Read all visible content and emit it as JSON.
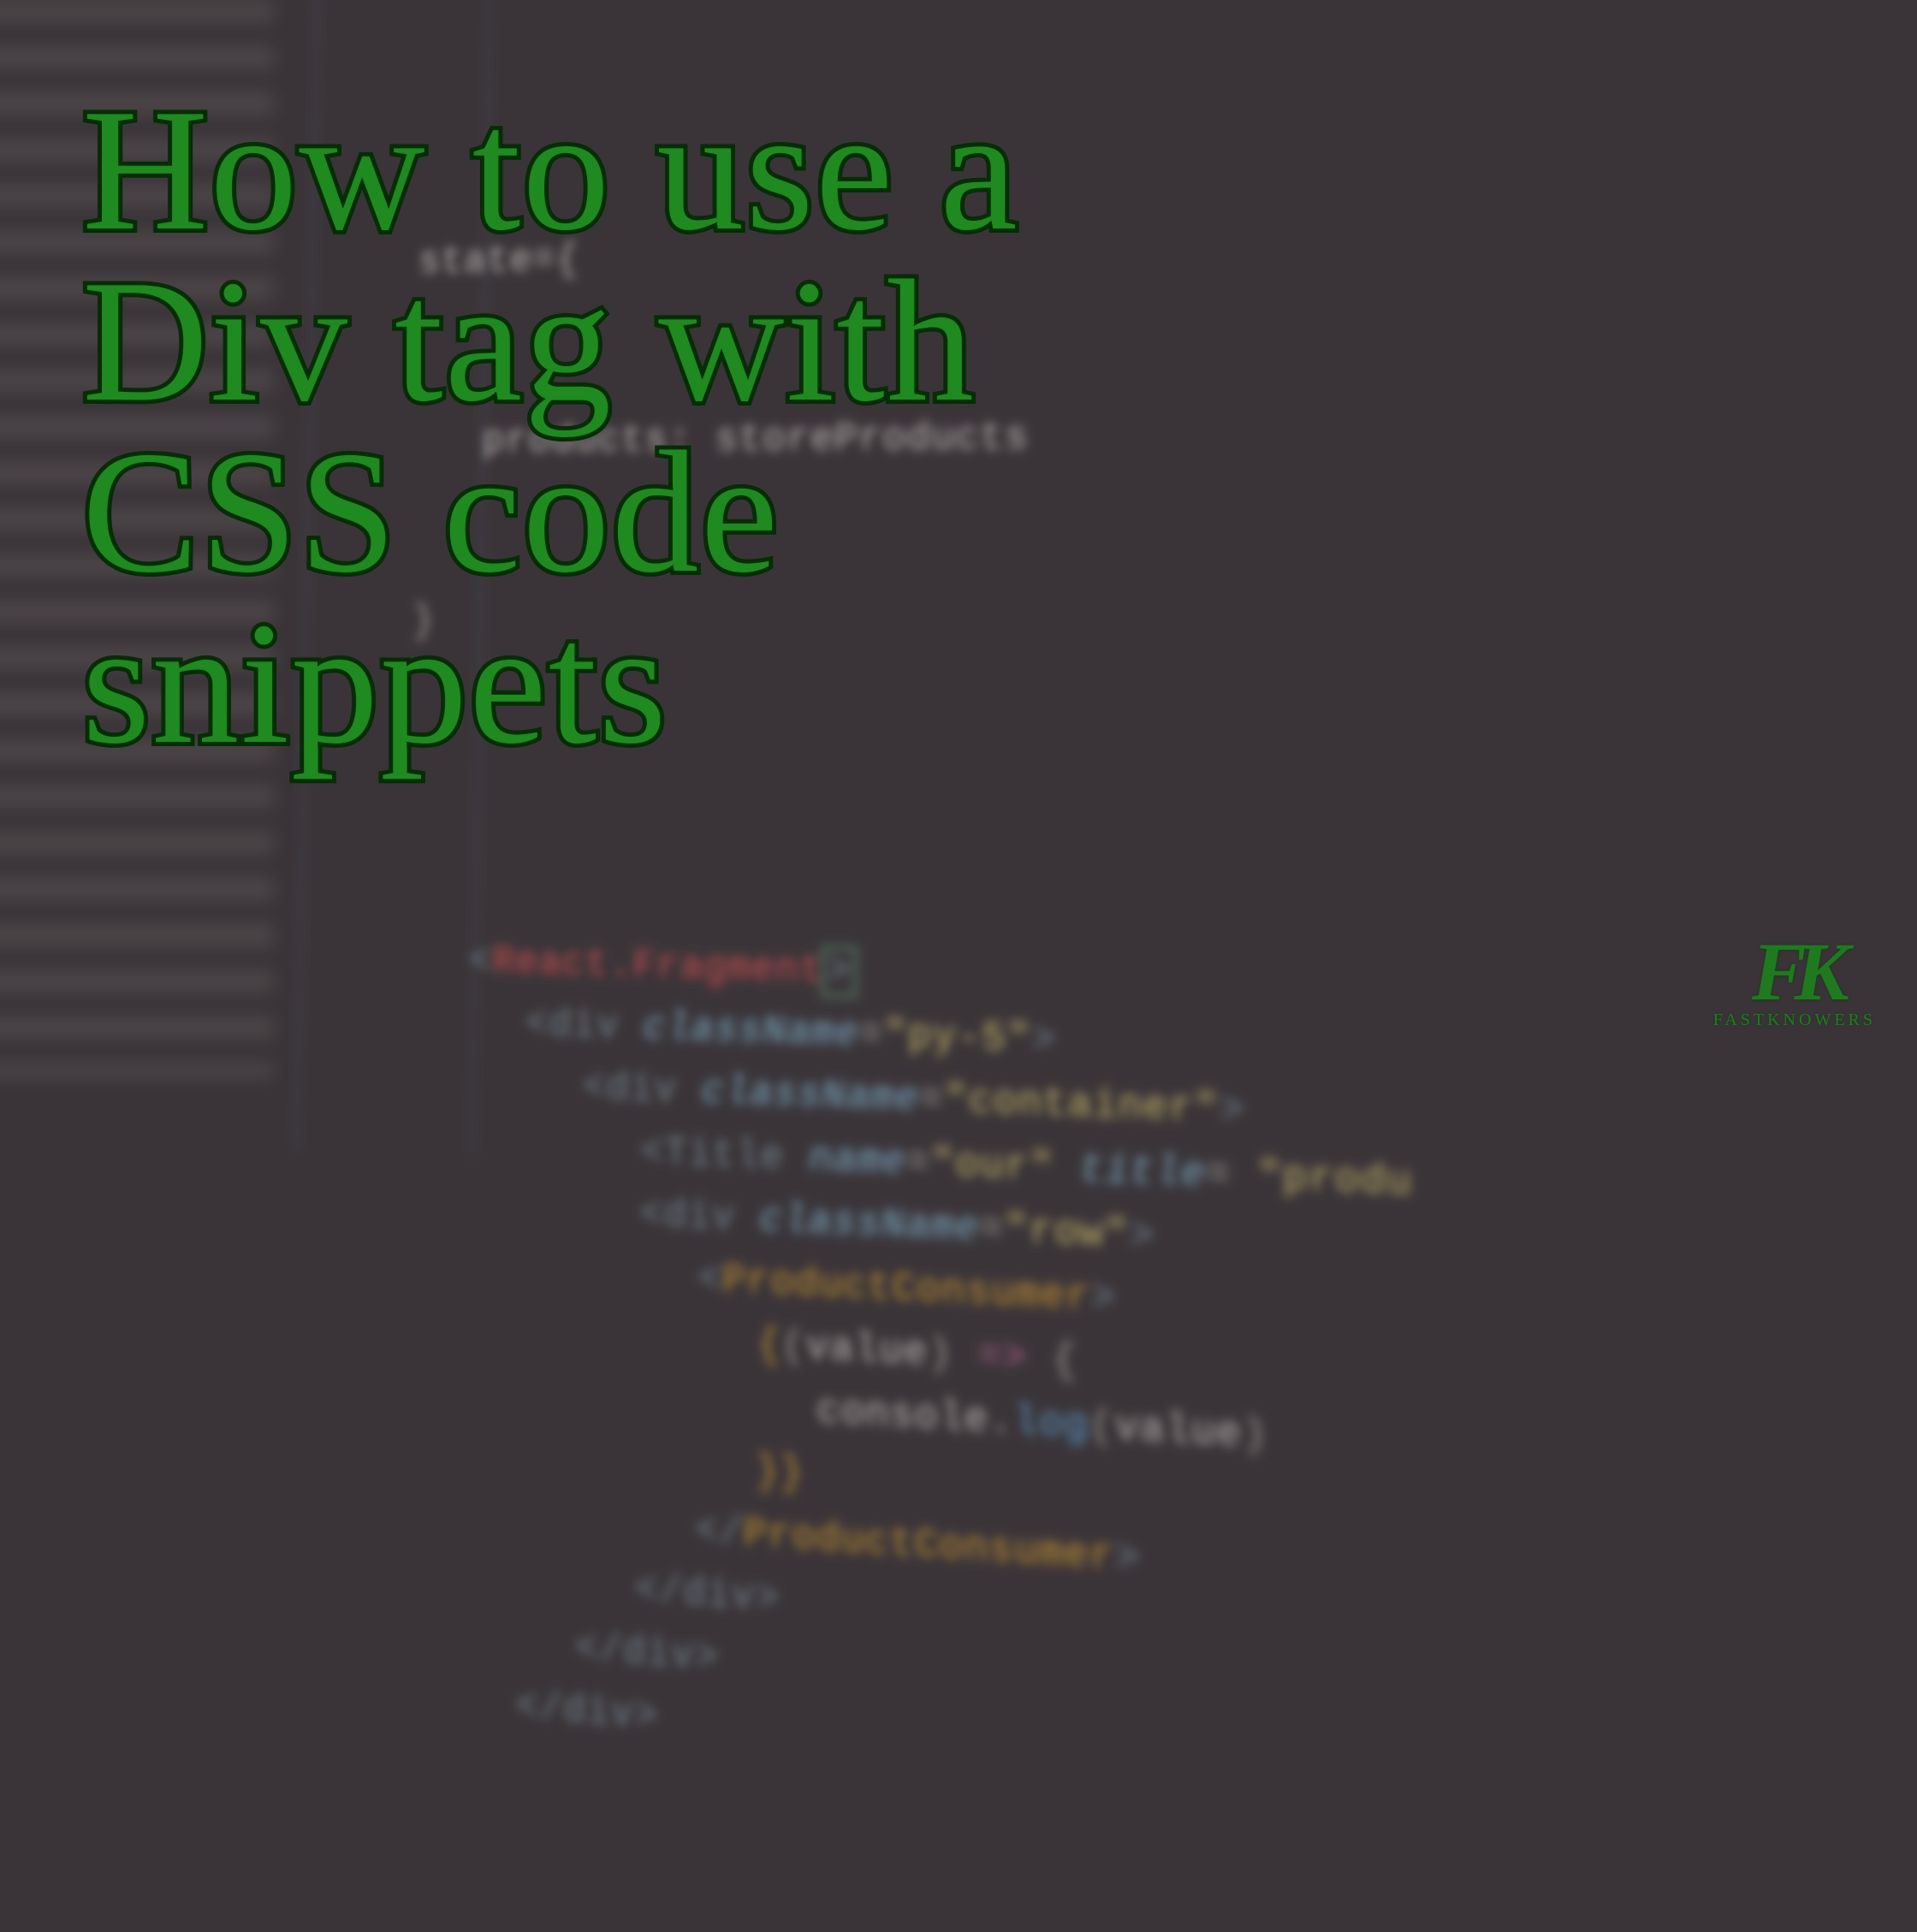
{
  "title_lines": [
    "How to use a",
    "Div tag with",
    "CSS code",
    "snippets"
  ],
  "watermark": {
    "initials": "FK",
    "name": "FASTKNOWERS"
  },
  "code": {
    "prelude": [
      {
        "text": "state={",
        "cls": "w"
      },
      {
        "text": "products: storeProducts",
        "cls": "w"
      },
      {
        "text": "}",
        "cls": "punc"
      }
    ],
    "lines": [
      {
        "n": "",
        "indent": 3,
        "tokens": [
          {
            "t": "<",
            "c": "delim"
          },
          {
            "t": "React.Fragment",
            "c": "tag"
          },
          {
            "t": ">",
            "c": "delim cursor"
          }
        ]
      },
      {
        "n": "",
        "indent": 4,
        "tokens": [
          {
            "t": "<div ",
            "c": "delim"
          },
          {
            "t": "className",
            "c": "attr"
          },
          {
            "t": "=",
            "c": "punc"
          },
          {
            "t": "\"py-5\"",
            "c": "str"
          },
          {
            "t": ">",
            "c": "delim"
          }
        ]
      },
      {
        "n": "",
        "indent": 5,
        "tokens": [
          {
            "t": "<div ",
            "c": "delim"
          },
          {
            "t": "className",
            "c": "attr"
          },
          {
            "t": "=",
            "c": "punc"
          },
          {
            "t": "\"container\"",
            "c": "str"
          },
          {
            "t": ">",
            "c": "delim"
          }
        ]
      },
      {
        "n": "",
        "indent": 6,
        "tokens": [
          {
            "t": "<Title ",
            "c": "delim"
          },
          {
            "t": "name",
            "c": "attr"
          },
          {
            "t": "=",
            "c": "punc"
          },
          {
            "t": "\"our\"",
            "c": "str"
          },
          {
            "t": " ",
            "c": "w"
          },
          {
            "t": "title",
            "c": "attr"
          },
          {
            "t": "= ",
            "c": "punc"
          },
          {
            "t": "\"produ",
            "c": "str"
          }
        ]
      },
      {
        "n": "",
        "indent": 6,
        "tokens": [
          {
            "t": "<div ",
            "c": "delim"
          },
          {
            "t": "className",
            "c": "attr"
          },
          {
            "t": "=",
            "c": "punc"
          },
          {
            "t": "\"row\"",
            "c": "str"
          },
          {
            "t": ">",
            "c": "delim"
          }
        ]
      },
      {
        "n": "",
        "indent": 7,
        "tokens": [
          {
            "t": "<",
            "c": "delim"
          },
          {
            "t": "ProductConsumer",
            "c": "comp"
          },
          {
            "t": ">",
            "c": "delim"
          }
        ]
      },
      {
        "n": "",
        "indent": 8,
        "tokens": [
          {
            "t": "{",
            "c": "comp"
          },
          {
            "t": "(",
            "c": "punc"
          },
          {
            "t": "value",
            "c": "w"
          },
          {
            "t": ") ",
            "c": "punc"
          },
          {
            "t": "=>",
            "c": "kw"
          },
          {
            "t": " {",
            "c": "punc"
          }
        ]
      },
      {
        "n": "",
        "indent": 9,
        "tokens": [
          {
            "t": "console",
            "c": "w"
          },
          {
            "t": ".",
            "c": "punc"
          },
          {
            "t": "log",
            "c": "fn"
          },
          {
            "t": "(",
            "c": "punc"
          },
          {
            "t": "value",
            "c": "w"
          },
          {
            "t": ")",
            "c": "punc"
          }
        ]
      },
      {
        "n": "",
        "indent": 8,
        "tokens": [
          {
            "t": "}}",
            "c": "comp"
          }
        ]
      },
      {
        "n": "",
        "indent": 7,
        "tokens": [
          {
            "t": "</",
            "c": "delim"
          },
          {
            "t": "ProductConsumer",
            "c": "comp"
          },
          {
            "t": ">",
            "c": "delim"
          }
        ]
      },
      {
        "n": "",
        "indent": 6,
        "tokens": [
          {
            "t": "</div>",
            "c": "delim"
          }
        ]
      },
      {
        "n": "",
        "indent": 5,
        "tokens": [
          {
            "t": "</div>",
            "c": "delim"
          }
        ]
      },
      {
        "n": "",
        "indent": 4,
        "tokens": [
          {
            "t": "</div>",
            "c": "delim"
          }
        ]
      }
    ]
  },
  "colors": {
    "title_fill": "#1f8a1f",
    "title_stroke": "#062d06",
    "bg": "#3a3438"
  }
}
